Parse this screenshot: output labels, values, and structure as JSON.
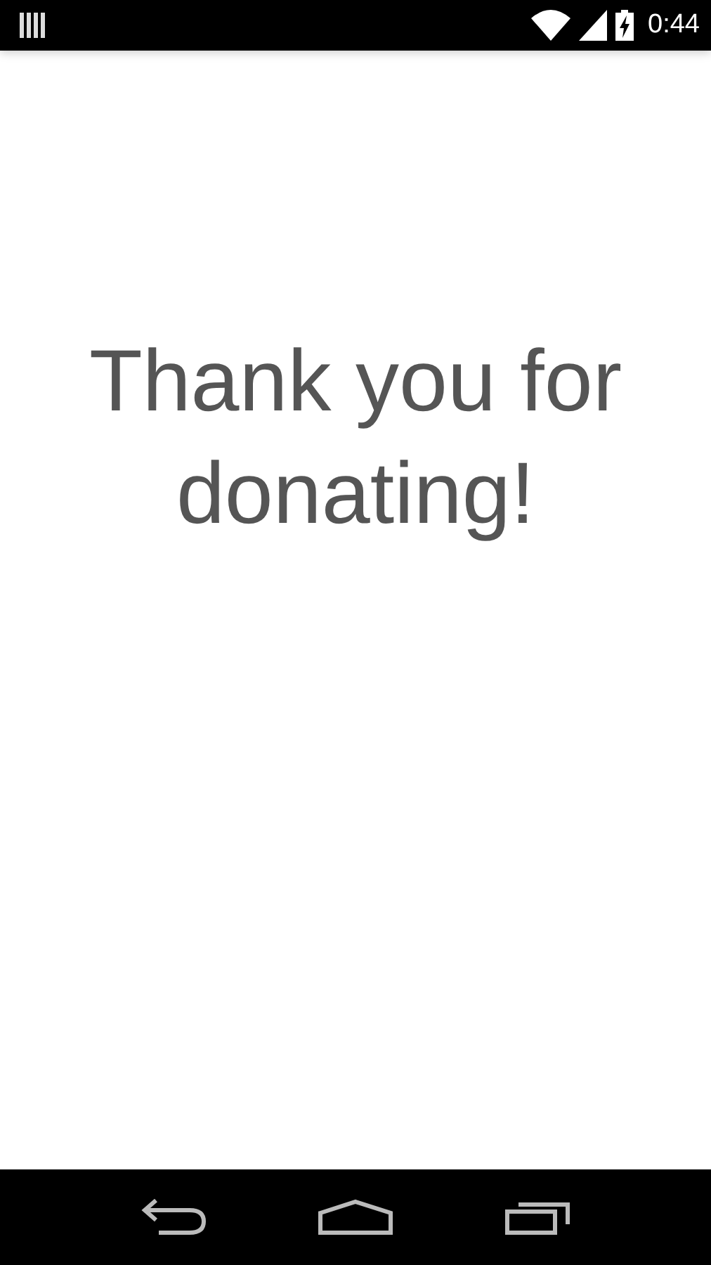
{
  "status_bar": {
    "time": "0:44"
  },
  "message": "Thank you for donating!"
}
